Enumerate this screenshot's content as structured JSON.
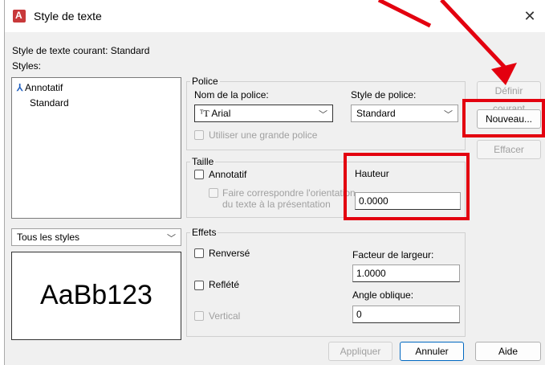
{
  "window": {
    "title": "Style de texte"
  },
  "current_style_label": "Style de texte courant: Standard",
  "styles": {
    "label": "Styles:",
    "items": [
      {
        "label": "Annotatif",
        "icon": "annotative-icon"
      },
      {
        "label": "Standard"
      }
    ],
    "filter_value": "Tous les styles",
    "preview_text": "AaBb123"
  },
  "font": {
    "group_label": "Police",
    "name_label": "Nom de la police:",
    "name_value": "Arial",
    "style_label": "Style de police:",
    "style_value": "Standard",
    "big_font_label": "Utiliser une grande police"
  },
  "size": {
    "group_label": "Taille",
    "annotative_label": "Annotatif",
    "match_orientation_line1": "Faire correspondre l'orientation",
    "match_orientation_line2": "du texte à la présentation",
    "height_label": "Hauteur",
    "height_value": "0.0000"
  },
  "effects": {
    "group_label": "Effets",
    "upside_down_label": "Renversé",
    "backwards_label": "Reflété",
    "vertical_label": "Vertical",
    "width_factor_label": "Facteur de largeur:",
    "width_factor_value": "1.0000",
    "oblique_angle_label": "Angle oblique:",
    "oblique_angle_value": "0"
  },
  "buttons": {
    "set_current": "Définir courant",
    "new": "Nouveau...",
    "delete": "Effacer",
    "apply": "Appliquer",
    "cancel": "Annuler",
    "help": "Aide"
  },
  "annotation_color": "#e3000f"
}
